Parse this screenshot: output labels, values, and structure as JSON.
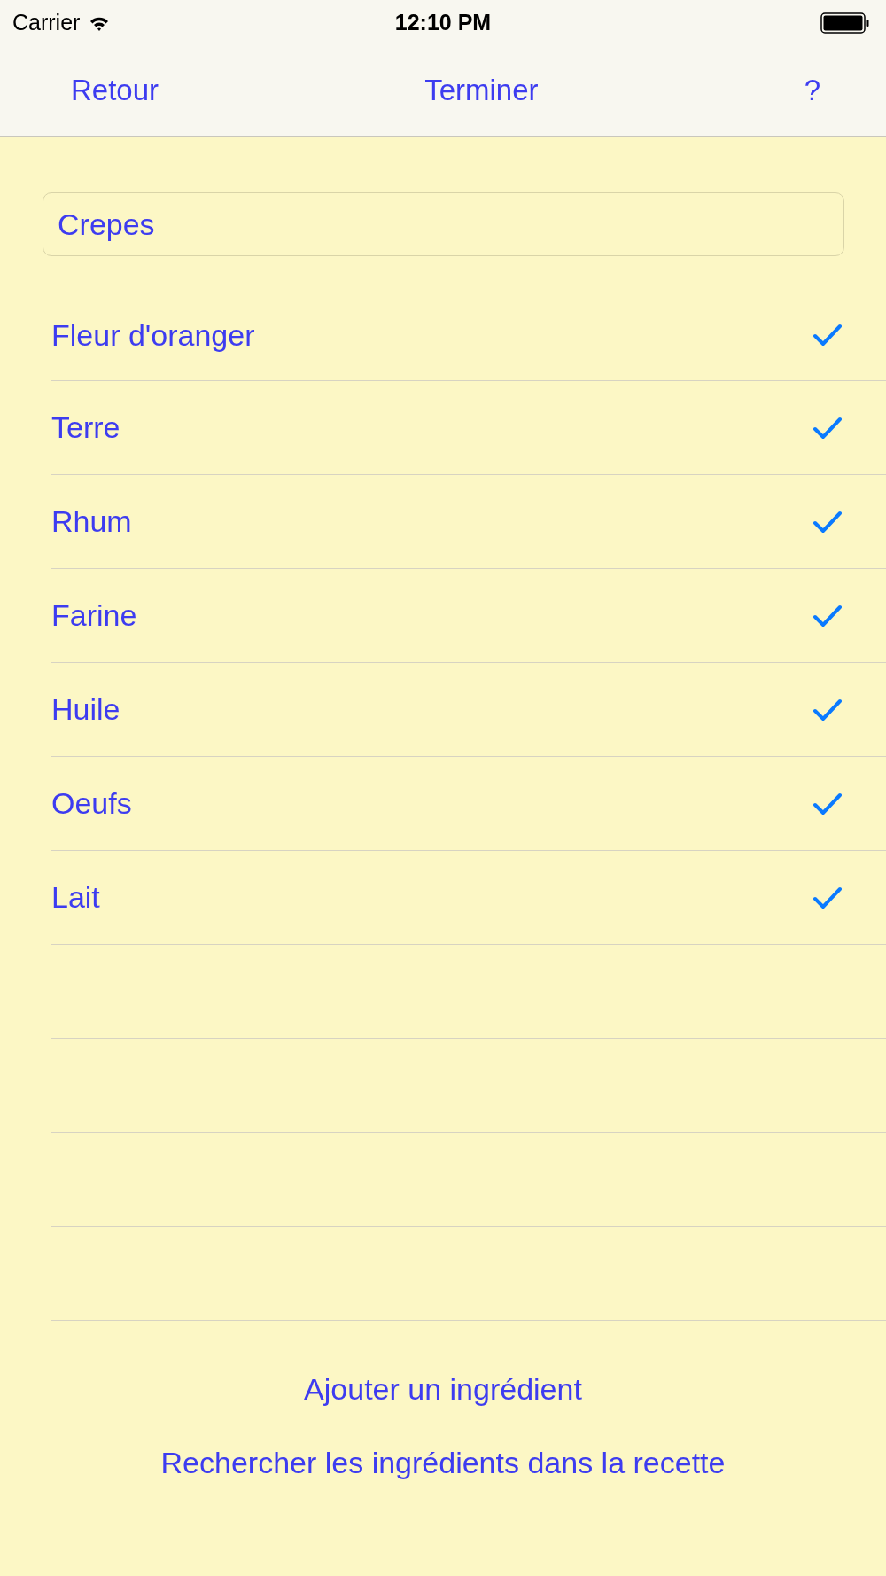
{
  "status_bar": {
    "carrier": "Carrier",
    "time": "12:10 PM"
  },
  "nav_bar": {
    "back": "Retour",
    "done": "Terminer",
    "help": "?"
  },
  "recipe_field": {
    "value": "Crepes"
  },
  "ingredients": [
    {
      "name": "Fleur d'oranger",
      "checked": true
    },
    {
      "name": "Terre",
      "checked": true
    },
    {
      "name": "Rhum",
      "checked": true
    },
    {
      "name": "Farine",
      "checked": true
    },
    {
      "name": "Huile",
      "checked": true
    },
    {
      "name": "Oeufs",
      "checked": true
    },
    {
      "name": "Lait",
      "checked": true
    }
  ],
  "actions": [
    "Ajouter un ingrédient",
    "Rechercher les ingrédients dans la recette"
  ]
}
